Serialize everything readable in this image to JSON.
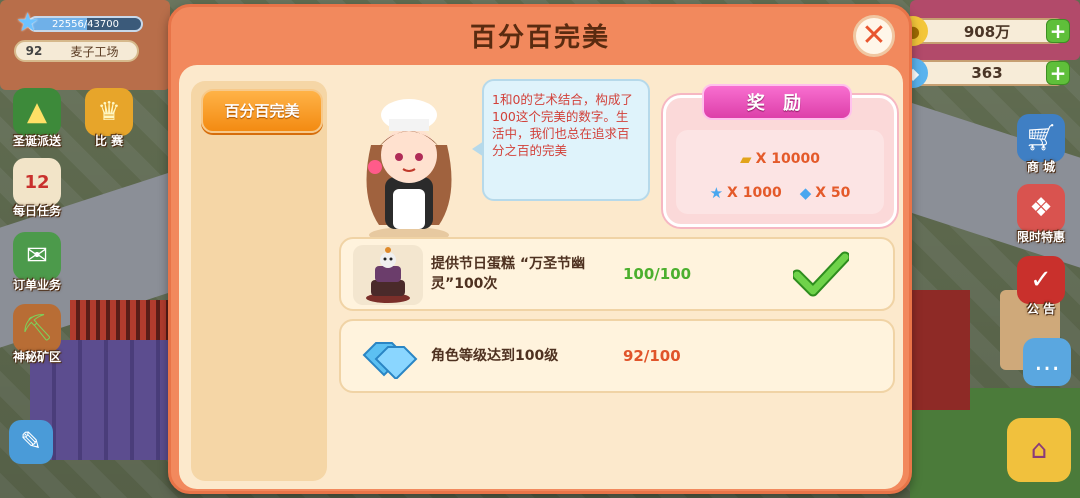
{
  "hud": {
    "xp": "22556/43700",
    "xp_fraction": 0.516,
    "level": "92",
    "shop_name": "麦子工场"
  },
  "currency": {
    "gold": "908万",
    "gems": "363"
  },
  "left_menu": [
    {
      "label": "圣诞派送",
      "icon": "christmas-tree-icon"
    },
    {
      "label": "比 赛",
      "icon": "trophy-icon"
    },
    {
      "label": "每日任务",
      "icon": "calendar-icon"
    },
    {
      "label": "订单业务",
      "icon": "delivery-icon"
    },
    {
      "label": "神秘矿区",
      "icon": "mine-icon"
    }
  ],
  "right_menu": [
    {
      "label": "商 城",
      "icon": "cart-icon"
    },
    {
      "label": "限时特惠",
      "icon": "gift-icon"
    },
    {
      "label": "公 告",
      "icon": "notice-board-icon"
    }
  ],
  "dialog": {
    "title": "百分百完美",
    "tab_active": "百分百完美",
    "speech": "1和0的艺术结合，构成了100这个完美的数字。生活中，我们也总在追求百分之百的完美",
    "reward": {
      "title": "奖 励",
      "gold": "X 10000",
      "stars": "X 1000",
      "gems": "X 50"
    },
    "tasks": [
      {
        "desc": "提供节日蛋糕 “万圣节幽灵”100次",
        "progress": "100/100",
        "complete": true
      },
      {
        "desc": "角色等级达到100级",
        "progress": "92/100",
        "complete": false
      }
    ]
  },
  "colors": {
    "dialog_bg": "#f2895d",
    "panel_bg": "#fce9cc",
    "tab_active": "#f38b12",
    "progress_done": "#4caf2e",
    "progress_pending": "#e0542a",
    "reward_ribbon": "#dd3fa9"
  }
}
